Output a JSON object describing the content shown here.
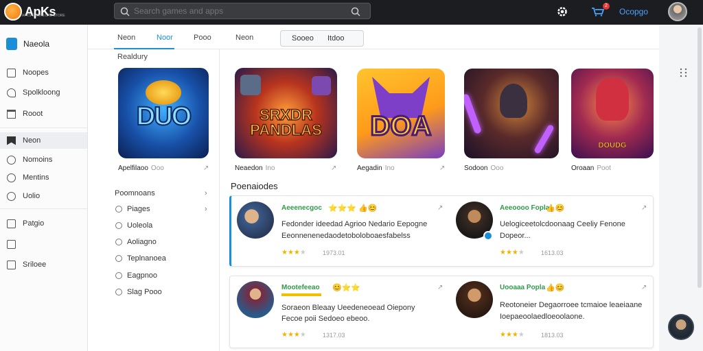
{
  "app": {
    "logo_text": "ApKs",
    "logo_sub": "APKS DOWNLOAD STORE"
  },
  "search": {
    "placeholder": "Search games and apps"
  },
  "header": {
    "cart_count": "2",
    "user": "Ocopgo"
  },
  "sidebar": {
    "brand": "Naeola",
    "items": [
      {
        "label": "Noopes",
        "icon": "home-icon"
      },
      {
        "label": "Spolkloong",
        "icon": "tag-icon"
      },
      {
        "label": "Rooot",
        "icon": "calendar-icon"
      },
      {
        "label": "Neon",
        "icon": "bookmark-icon"
      },
      {
        "label": "Nomoins",
        "icon": "globe-icon"
      },
      {
        "label": "Mentins",
        "icon": "circle-icon"
      },
      {
        "label": "Uolio",
        "icon": "clock-icon"
      },
      {
        "label": "Patgio",
        "icon": "document-icon"
      },
      {
        "label": "",
        "icon": "chart-icon"
      },
      {
        "label": "Sriloee",
        "icon": "window-icon"
      }
    ]
  },
  "tabs": [
    "Neon",
    "Noor",
    "Pooo",
    "Neon"
  ],
  "segment": [
    "Sooeo",
    "Itdoo"
  ],
  "section_label": "Realdury",
  "tiles": [
    {
      "art": "DUO",
      "name": "Apelfilaoo",
      "sub": "Ooo"
    },
    {
      "art": "SRXDR PANDLAS",
      "name": "Neaedon",
      "sub": "Ino"
    },
    {
      "art": "DOA",
      "name": "Aegadin",
      "sub": "Ino"
    },
    {
      "art": "",
      "name": "Sodoon",
      "sub": "Ooo"
    },
    {
      "art": "DOUDG",
      "name": "Oroaan",
      "sub": "Poot"
    }
  ],
  "mid_list": {
    "head": "Poomnoans",
    "items": [
      "Piages",
      "Uoleola",
      "Aoliagno",
      "Teplnanoea",
      "Eagpnoo",
      "Slag Pooo"
    ]
  },
  "recommendations": {
    "title": "Poenaiodes",
    "reviews": [
      {
        "name": "Aeeenecgoc",
        "emoji": "⭐⭐⭐ 👍😊",
        "line1": "Fedonder ideedad Agrioo Nedario Eepogne",
        "line2": "Eeonnenenedaodetoboloboaesfabelss",
        "stars": "★★★",
        "dim": "★",
        "date": "1973.01"
      },
      {
        "name": "Aeeoooo Fopla",
        "emoji": "👍😊",
        "line1": "Uelogiceetolcdoonaag Ceeliy Fenone",
        "line2": "Dopeor...",
        "stars": "★★★",
        "dim": "★",
        "date": "1613.03"
      },
      {
        "name": "Mootefeeao",
        "emoji": "😊⭐⭐",
        "line1": "Soraeon Bleaay Ueedeneoead Oiepony",
        "line2": "Fecoe poii Sedoeo ebeoo.",
        "stars": "★★★",
        "dim": "★",
        "date": "1317.03"
      },
      {
        "name": "Uooaaa Popla",
        "emoji": "👍😊",
        "line1": "Reotoneier Degaorroee tcmaioe leaeiaane",
        "line2": "Ioepaeoolaedloeoolaone.",
        "stars": "★★★",
        "dim": "★",
        "date": "1813.03"
      }
    ]
  },
  "colors": {
    "accent": "#1a8fd8",
    "topbar": "#1c1d20",
    "orange": "#f07a10"
  }
}
